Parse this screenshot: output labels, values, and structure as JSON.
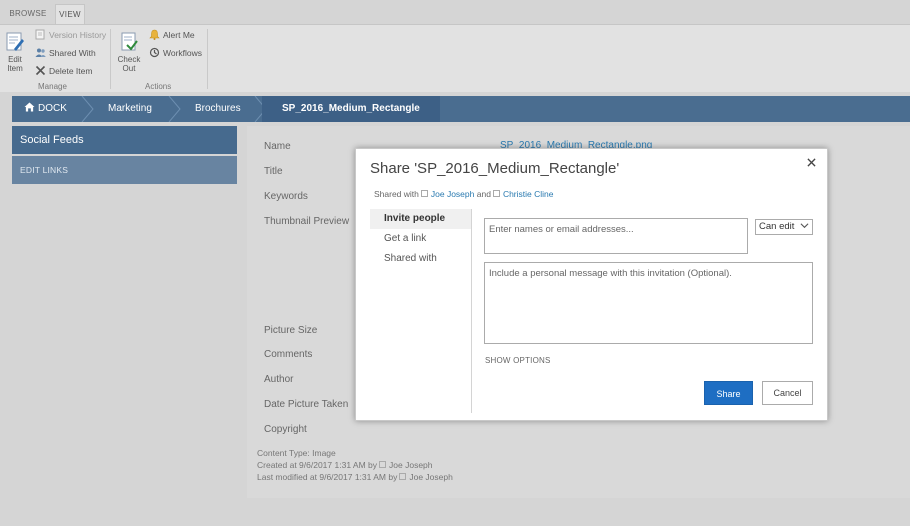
{
  "ribbon": {
    "tabs": [
      {
        "label": "BROWSE"
      },
      {
        "label": "VIEW"
      }
    ],
    "manage": {
      "edit_item": "Edit Item",
      "version_history": "Version History",
      "shared_with": "Shared With",
      "delete_item": "Delete Item",
      "group_label": "Manage"
    },
    "actions": {
      "check_out": "Check Out",
      "alert_me": "Alert Me",
      "workflows": "Workflows",
      "group_label": "Actions"
    }
  },
  "breadcrumb": {
    "home": "DOCK",
    "items": [
      "Marketing",
      "Brochures"
    ],
    "current": "SP_2016_Medium_Rectangle"
  },
  "leftnav": {
    "social_feeds": "Social Feeds",
    "edit_links": "EDIT LINKS"
  },
  "properties": {
    "labels": {
      "name": "Name",
      "title": "Title",
      "keywords": "Keywords",
      "thumbnail": "Thumbnail Preview",
      "picture_size": "Picture Size",
      "comments": "Comments",
      "author": "Author",
      "date_taken": "Date Picture Taken",
      "copyright": "Copyright"
    },
    "name_value": "SP_2016_Medium_Rectangle.png",
    "content_type": "Content Type: Image",
    "created": "Created at 9/6/2017 1:31 AM  by",
    "created_by": "Joe Joseph",
    "modified": "Last modified at 9/6/2017 1:31 AM  by",
    "modified_by": "Joe Joseph"
  },
  "dialog": {
    "title": "Share 'SP_2016_Medium_Rectangle'",
    "shared_with_label": "Shared with",
    "shared_user_1": "Joe Joseph",
    "and": "and",
    "shared_user_2": "Christie Cline",
    "side": {
      "invite": "Invite people",
      "get_link": "Get a link",
      "shared_with": "Shared with"
    },
    "names_placeholder": "Enter names or email addresses...",
    "permission": "Can edit",
    "message_placeholder": "Include a personal message with this invitation (Optional).",
    "show_options": "SHOW OPTIONS",
    "share_button": "Share",
    "cancel_button": "Cancel"
  }
}
